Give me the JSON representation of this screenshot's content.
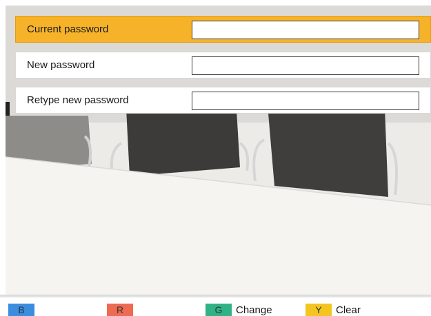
{
  "form": {
    "rows": [
      {
        "label": "Current password",
        "value": "",
        "selected": true
      },
      {
        "label": "New password",
        "value": "",
        "selected": false
      },
      {
        "label": "Retype new password",
        "value": "",
        "selected": false
      }
    ]
  },
  "keys": [
    {
      "letter": "B",
      "color": "#3b8de0",
      "label": ""
    },
    {
      "letter": "R",
      "color": "#ee6a52",
      "label": ""
    },
    {
      "letter": "G",
      "color": "#2fb386",
      "label": "Change"
    },
    {
      "letter": "Y",
      "color": "#f4c521",
      "label": "Clear"
    }
  ],
  "colors": {
    "selected_row": "#f6b32a",
    "background": "#e7e6e3"
  }
}
